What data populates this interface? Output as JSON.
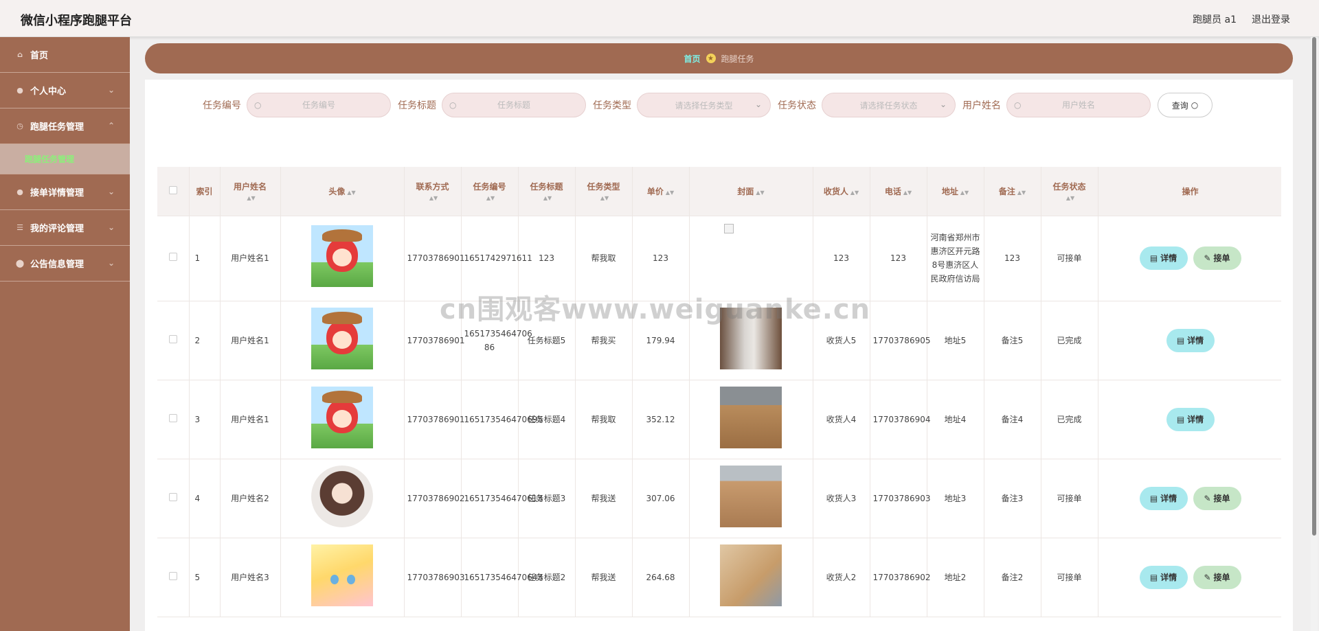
{
  "header": {
    "title": "微信小程序跑腿平台",
    "user": "跑腿员 a1",
    "logout": "退出登录"
  },
  "sidebar": {
    "items": [
      {
        "label": "首页"
      },
      {
        "label": "个人中心"
      },
      {
        "label": "跑腿任务管理"
      },
      {
        "label": "跑腿任务管理"
      },
      {
        "label": "接单详情管理"
      },
      {
        "label": "我的评论管理"
      },
      {
        "label": "公告信息管理"
      }
    ]
  },
  "breadcrumb": {
    "home": "首页",
    "current": "跑腿任务"
  },
  "filters": {
    "task_no_label": "任务编号",
    "task_no_placeholder": "任务编号",
    "task_title_label": "任务标题",
    "task_title_placeholder": "任务标题",
    "task_type_label": "任务类型",
    "task_type_placeholder": "请选择任务类型",
    "task_status_label": "任务状态",
    "task_status_placeholder": "请选择任务状态",
    "user_name_label": "用户姓名",
    "user_name_placeholder": "用户姓名",
    "query": "查询"
  },
  "table": {
    "headers": [
      "索引",
      "用户姓名",
      "头像",
      "联系方式",
      "任务编号",
      "任务标题",
      "任务类型",
      "单价",
      "封面",
      "收货人",
      "电话",
      "地址",
      "备注",
      "任务状态",
      "操作"
    ],
    "rows": [
      {
        "index": "1",
        "user": "用户姓名1",
        "phone": "17703786901",
        "task_no": "1651742971611",
        "title": "123",
        "type": "帮我取",
        "price": "123",
        "receiver": "123",
        "tel": "123",
        "address": "河南省郑州市惠济区开元路8号惠济区人民政府信访局",
        "remark": "123",
        "status": "可接单"
      },
      {
        "index": "2",
        "user": "用户姓名1",
        "phone": "17703786901",
        "task_no": "1651735464706 86",
        "title": "任务标题5",
        "type": "帮我买",
        "price": "179.94",
        "receiver": "收货人5",
        "tel": "17703786905",
        "address": "地址5",
        "remark": "备注5",
        "status": "已完成"
      },
      {
        "index": "3",
        "user": "用户姓名1",
        "phone": "17703786901",
        "task_no": "165173546470695",
        "title": "任务标题4",
        "type": "帮我取",
        "price": "352.12",
        "receiver": "收货人4",
        "tel": "17703786904",
        "address": "地址4",
        "remark": "备注4",
        "status": "已完成"
      },
      {
        "index": "4",
        "user": "用户姓名2",
        "phone": "17703786902",
        "task_no": "165173546470613",
        "title": "任务标题3",
        "type": "帮我送",
        "price": "307.06",
        "receiver": "收货人3",
        "tel": "17703786903",
        "address": "地址3",
        "remark": "备注3",
        "status": "可接单"
      },
      {
        "index": "5",
        "user": "用户姓名3",
        "phone": "17703786903",
        "task_no": "165173546470643",
        "title": "任务标题2",
        "type": "帮我送",
        "price": "264.68",
        "receiver": "收货人2",
        "tel": "17703786902",
        "address": "地址2",
        "remark": "备注2",
        "status": "可接单"
      }
    ]
  },
  "buttons": {
    "detail": "详情",
    "take": "接单"
  },
  "watermark": "cn围观客www.weiguanke.cn",
  "colors": {
    "brand": "#a06a52",
    "detail_btn": "#a8e9ee",
    "take_btn": "#c6e6c7",
    "active_sub": "#8cf07a"
  }
}
